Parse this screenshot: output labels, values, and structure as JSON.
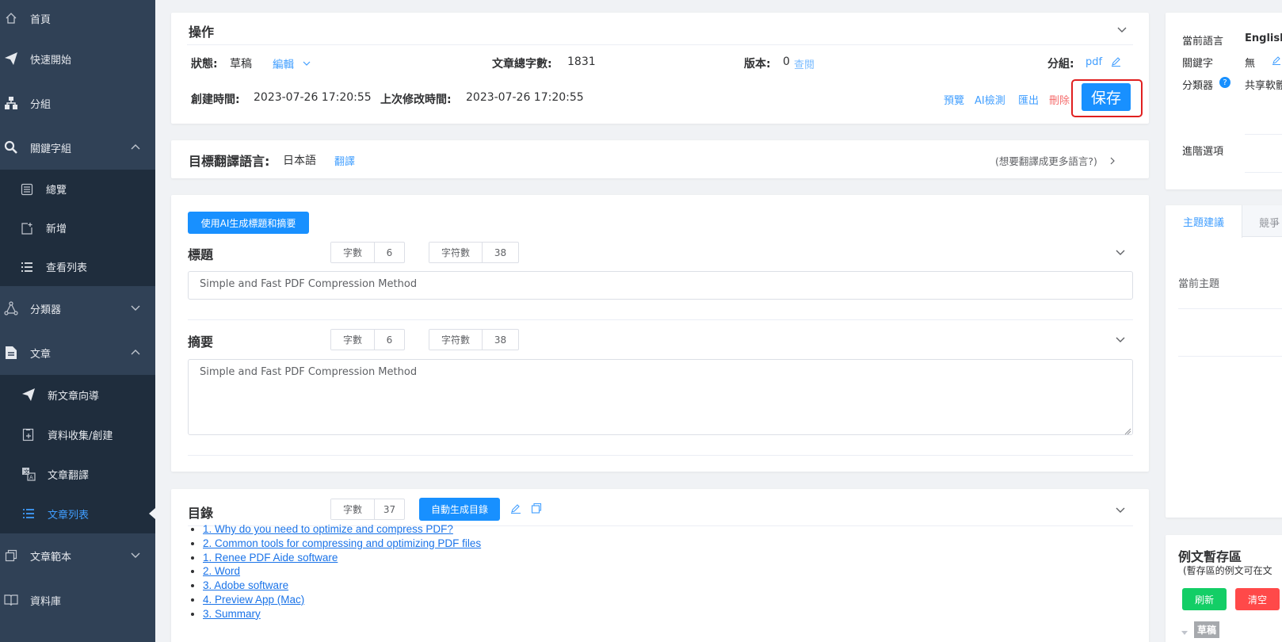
{
  "sidebar": {
    "items": [
      {
        "label": "首頁",
        "icon": "home-icon"
      },
      {
        "label": "快速開始",
        "icon": "paper-plane-icon"
      },
      {
        "label": "分組",
        "icon": "org-chart-icon"
      },
      {
        "label": "關鍵字組",
        "icon": "search-magnifier-icon"
      }
    ],
    "keyword_sub": [
      {
        "label": "總覽",
        "icon": "list-box-icon"
      },
      {
        "label": "新增",
        "icon": "new-doc-icon"
      },
      {
        "label": "查看列表",
        "icon": "list-icon"
      }
    ],
    "classifier": {
      "label": "分類器",
      "icon": "share-nodes-icon"
    },
    "article": {
      "label": "文章",
      "icon": "document-icon"
    },
    "article_sub": [
      {
        "label": "新文章向導",
        "icon": "paper-plane-icon"
      },
      {
        "label": "資料收集/創建",
        "icon": "clipboard-add-icon"
      },
      {
        "label": "文章翻譯",
        "icon": "translate-icon"
      },
      {
        "label": "文章列表",
        "icon": "list-icon"
      }
    ],
    "templates": {
      "label": "文章範本",
      "icon": "copy-icon"
    },
    "library": {
      "label": "資料庫",
      "icon": "book-icon"
    }
  },
  "ops": {
    "title": "操作",
    "status_label": "狀態:",
    "status_value": "草稿",
    "edit_label": "編輯",
    "wordcount_label": "文章總字數:",
    "wordcount_value": "1831",
    "version_label": "版本:",
    "version_value": "0",
    "view_label": "查閱",
    "group_label": "分組:",
    "group_value": "pdf",
    "created_label": "創建時間:",
    "created_value": "2023-07-26 17:20:55",
    "modified_label": "上次修改時間:",
    "modified_value": "2023-07-26 17:20:55",
    "actions": [
      "預覽",
      "AI檢測",
      "匯出",
      "刪除"
    ],
    "save_label": "保存"
  },
  "translate": {
    "title": "目標翻譯語言:",
    "language": "日本語",
    "action": "翻譯",
    "more": "(想要翻譯成更多語言?)"
  },
  "content": {
    "ai_button": "使用AI生成標題和摘要",
    "title_label": "標題",
    "summary_label": "摘要",
    "chars_label": "字數",
    "charcount_label": "字符數",
    "title_chars": "6",
    "title_charcount": "38",
    "summary_chars": "6",
    "summary_charcount": "38",
    "title_value": "Simple and Fast PDF Compression Method",
    "summary_value": "Simple and Fast PDF Compression Method"
  },
  "toc": {
    "title": "目錄",
    "chars_label": "字數",
    "chars_value": "37",
    "auto_button": "自動生成目錄",
    "items": [
      "1. Why do you need to optimize and compress PDF?",
      "2. Common tools for compressing and optimizing PDF files",
      "1. Renee PDF Aide software",
      "2. Word",
      "3. Adobe software",
      "4. Preview App (Mac)",
      "3. Summary"
    ]
  },
  "right": {
    "lang_label": "當前語言",
    "lang_value": "English",
    "kw_label": "關鍵字",
    "kw_value": "無",
    "classifier_label": "分類器",
    "classifier_value": "共享軟體",
    "advanced": "進階選項",
    "tabs": [
      "主題建議",
      "競爭"
    ],
    "current_topic": "當前主題",
    "sample_title": "例文暫存區",
    "sample_desc": "(暫存區的例文可在文",
    "refresh": "刷新",
    "clear": "清空",
    "draft_tag": "草稿"
  },
  "colors": {
    "primary": "#409eff",
    "save": "#1890ff",
    "danger": "#f56c6c",
    "success": "#13ce66",
    "sidebar": "#304156"
  }
}
